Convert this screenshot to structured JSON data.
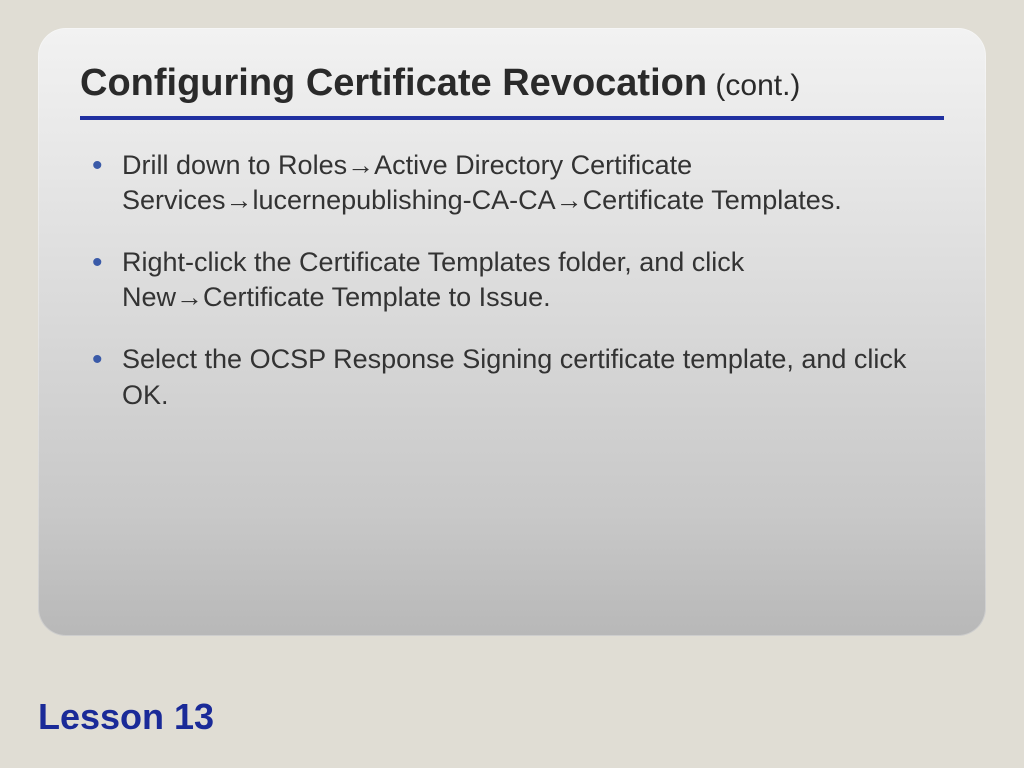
{
  "slide": {
    "title_main": "Configuring Certificate Revocation",
    "title_suffix": " (cont.)",
    "bullets": [
      "Drill down to Roles→Active Directory Certificate Services→lucernepublishing-CA-CA→Certificate Templates.",
      "Right-click the Certificate Templates folder, and click New→Certificate Template to Issue.",
      "Select the OCSP Response Signing certificate template, and click OK."
    ]
  },
  "footer": {
    "label": "Lesson 13"
  }
}
